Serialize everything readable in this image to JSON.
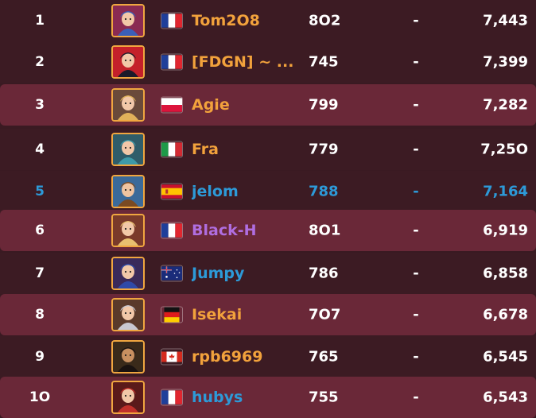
{
  "colors": {
    "name_orange": "#f2a23c",
    "name_purple": "#b06ee0",
    "name_blue": "#2d9ad8",
    "highlight_blue": "#2d9ad8",
    "row_light": "#6a2838",
    "row_dark": "#3c1b23",
    "avatar_border": "#f0a640"
  },
  "rows": [
    {
      "rank": "1",
      "name": "Tom2O8",
      "level": "8O2",
      "dash": "-",
      "points": "7,443",
      "flag": "fr",
      "name_color": "orange",
      "avatar": "blue-haired-girl"
    },
    {
      "rank": "2",
      "name": "[FDGN] ~ ...",
      "level": "745",
      "dash": "-",
      "points": "7,399",
      "flag": "fr",
      "name_color": "orange",
      "avatar": "masked-heroine"
    },
    {
      "rank": "3",
      "name": "Agie",
      "level": "799",
      "dash": "-",
      "points": "7,282",
      "flag": "pl",
      "name_color": "orange",
      "avatar": "blonde-girl"
    },
    {
      "rank": "4",
      "name": "Fra",
      "level": "779",
      "dash": "-",
      "points": "7,25O",
      "flag": "it",
      "name_color": "orange",
      "avatar": "teal-haired-girl"
    },
    {
      "rank": "5",
      "name": "jelom",
      "level": "788",
      "dash": "-",
      "points": "7,164",
      "flag": "es",
      "name_color": "blue",
      "avatar": "brown-haired-hero",
      "highlight": true
    },
    {
      "rank": "6",
      "name": "Black-H",
      "level": "8O1",
      "dash": "-",
      "points": "6,919",
      "flag": "fr",
      "name_color": "purple",
      "avatar": "blonde-girl-2"
    },
    {
      "rank": "7",
      "name": "Jumpy",
      "level": "786",
      "dash": "-",
      "points": "6,858",
      "flag": "au",
      "name_color": "blue",
      "avatar": "blue-haired-girl-2"
    },
    {
      "rank": "8",
      "name": "Isekai",
      "level": "7O7",
      "dash": "-",
      "points": "6,678",
      "flag": "de",
      "name_color": "orange",
      "avatar": "silver-haired-girl"
    },
    {
      "rank": "9",
      "name": "rpb6969",
      "level": "765",
      "dash": "-",
      "points": "6,545",
      "flag": "ca",
      "name_color": "orange",
      "avatar": "dark-figure"
    },
    {
      "rank": "1O",
      "name": "hubys",
      "level": "755",
      "dash": "-",
      "points": "6,543",
      "flag": "fr",
      "name_color": "blue",
      "avatar": "red-haired-girl"
    }
  ]
}
